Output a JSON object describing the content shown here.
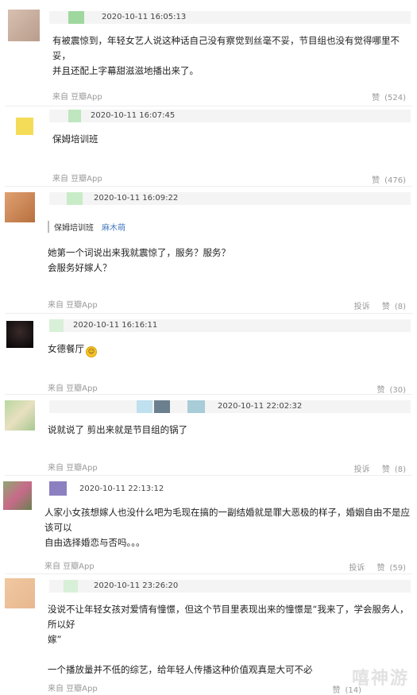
{
  "colors": {
    "accent": "#8fd18f",
    "muted": "#999999",
    "link": "#4a7cc0"
  },
  "comments": [
    {
      "timestamp": "2020-10-11 16:05:13",
      "lines": [
        "有被震惊到，年轻女艺人说这种话自己没有察觉到丝毫不妥，节目组也没有觉得哪里不妥，",
        "并且还配上字幕甜滋滋地播出来了。"
      ],
      "source": "来自 豆瓣App",
      "like_label": "赞",
      "like_count": "(524)"
    },
    {
      "timestamp": "2020-10-11 16:07:45",
      "lines": [
        "保姆培训班"
      ],
      "source": "来自 豆瓣App",
      "like_label": "赞",
      "like_count": "(476)"
    },
    {
      "timestamp": "2020-10-11 16:09:22",
      "quote_text": "保姆培训班",
      "quote_author": "麻木萌",
      "lines": [
        "她第一个词说出来我就震惊了，服务？服务？",
        "会服务好嫁人？"
      ],
      "source": "来自 豆瓣App",
      "report_label": "投诉",
      "like_label": "赞",
      "like_count": "(8)"
    },
    {
      "timestamp": "2020-10-11 16:16:11",
      "lines": [
        "女德餐厅"
      ],
      "source": "来自 豆瓣App",
      "like_label": "赞",
      "like_count": "(30)"
    },
    {
      "timestamp": "2020-10-11 22:02:32",
      "lines": [
        "说就说了 剪出来就是节目组的锅了"
      ],
      "source": "来自 豆瓣App",
      "report_label": "投诉",
      "like_label": "赞",
      "like_count": "(8)"
    },
    {
      "timestamp": "2020-10-11 22:13:12",
      "lines": [
        "人家小女孩想嫁人也没什么吧为毛现在搞的一副结婚就是罪大恶极的样子，婚姻自由不是应该可以",
        "自由选择婚恋与否吗。。。"
      ],
      "source": "来自 豆瓣App",
      "report_label": "投诉",
      "like_label": "赞",
      "like_count": "(59)"
    },
    {
      "timestamp": "2020-10-11 23:26:20",
      "lines": [
        "没说不让年轻女孩对爱情有憧憬，但这个节目里表现出来的憧憬是“我来了，学会服务人，所以好",
        "嫁”",
        "",
        "一个播放量并不低的综艺，给年轻人传播这种价值观真是大可不必"
      ],
      "source": "来自 豆瓣App",
      "like_label": "赞",
      "like_count": "(14)"
    }
  ],
  "watermark": "嘻神游"
}
